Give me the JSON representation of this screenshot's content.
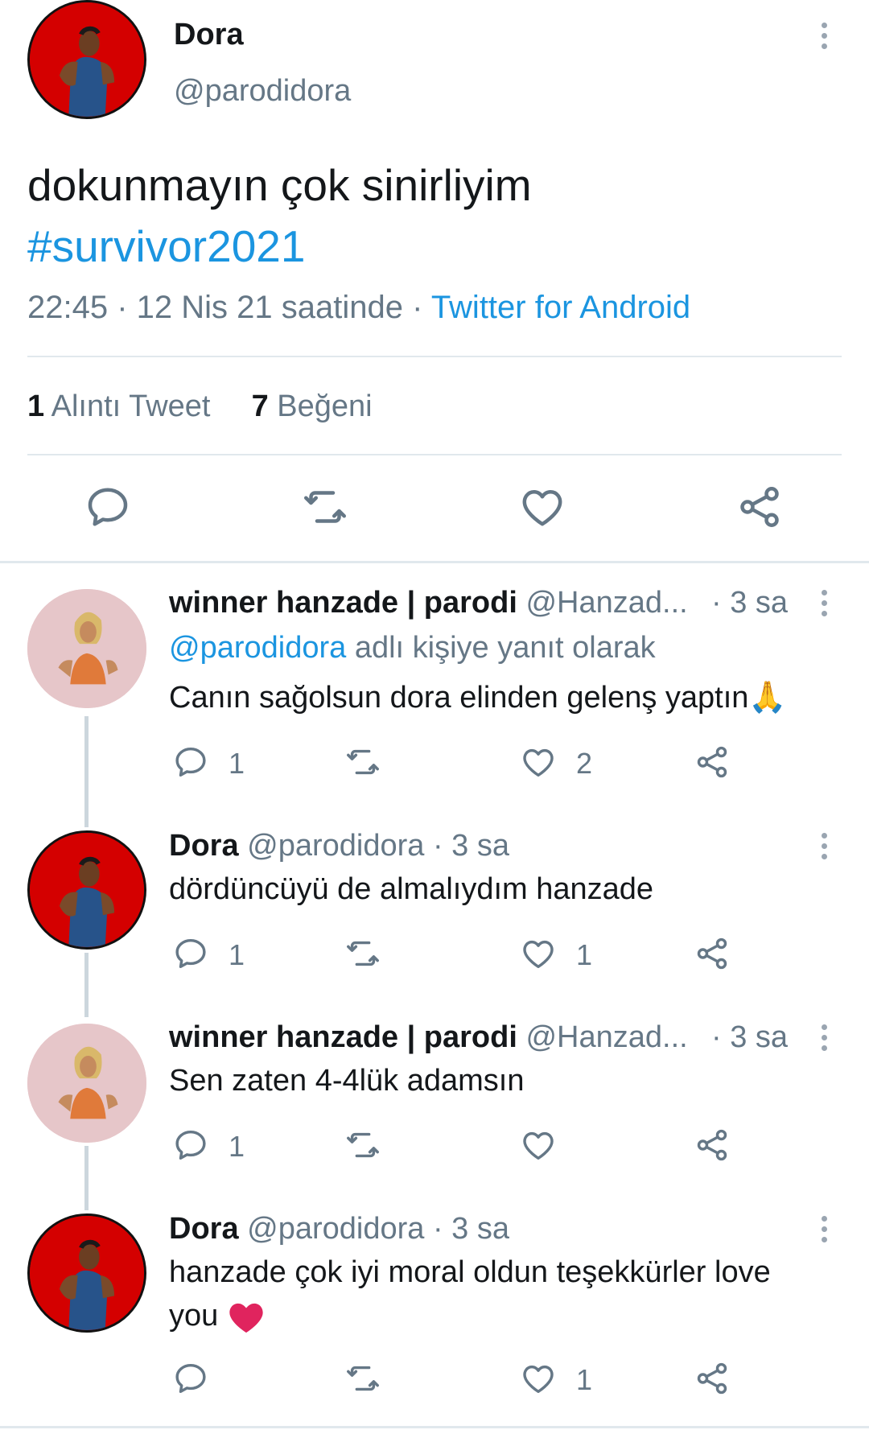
{
  "main_tweet": {
    "name": "Dora",
    "handle": "@parodidora",
    "text": "dokunmayın çok sinirliyim",
    "hashtag": "#survivor2021",
    "time": "22:45",
    "sep1": " · ",
    "date": "12 Nis 21 saatinde",
    "sep2": " · ",
    "source": "Twitter for Android",
    "quote_count": "1",
    "quote_label": "Alıntı Tweet",
    "like_count": "7",
    "like_label": "Beğeni",
    "actions": [
      "reply-icon",
      "retweet-icon",
      "like-icon",
      "share-icon"
    ]
  },
  "replies": [
    {
      "name": "winner hanzade | parodi",
      "handle": "@Hanzad...",
      "time": "· 3 sa",
      "replying_mention": "@parodidora",
      "replying_suffix": "adlı kişiye yanıt olarak",
      "text": "Canın sağolsun dora elinden gelenş yaptın🙏",
      "reply_count": "1",
      "retweet_count": "",
      "like_count": "2"
    },
    {
      "name": "Dora",
      "handle": "@parodidora",
      "time": "· 3 sa",
      "text": "dördüncüyü de almalıydım hanzade",
      "reply_count": "1",
      "retweet_count": "",
      "like_count": "1"
    },
    {
      "name": "winner hanzade | parodi",
      "handle": "@Hanzad...",
      "time": "· 3 sa",
      "text": "Sen zaten 4-4lük adamsın",
      "reply_count": "1",
      "retweet_count": "",
      "like_count": ""
    },
    {
      "name": "Dora",
      "handle": "@parodidora",
      "time": "· 3 sa",
      "text_line1": "hanzade çok iyi moral oldun teşekkürler love",
      "text_line2": "you",
      "reply_count": "",
      "retweet_count": "",
      "like_count": "1"
    }
  ],
  "colors": {
    "link": "#1b95e0",
    "secondary_text": "#657786",
    "avatar_red": "#d40000",
    "avatar_pink": "#e6c6c9",
    "heart_emoji": "#e0245e"
  }
}
